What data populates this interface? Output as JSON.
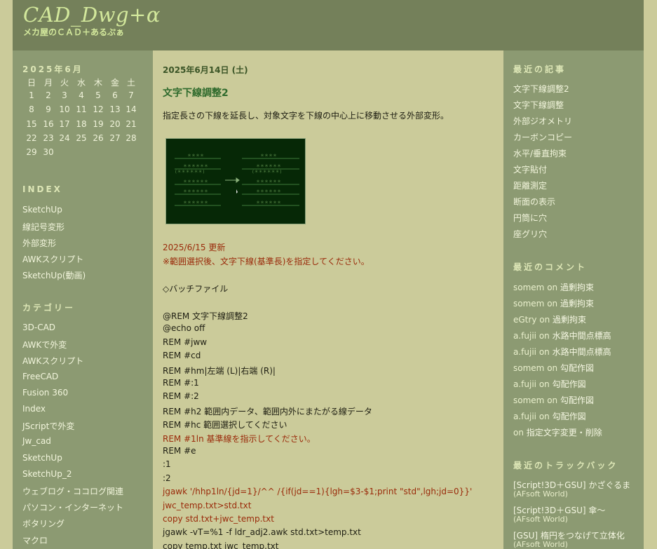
{
  "site": {
    "title": "CAD_Dwg+α",
    "subtitle": "メカ屋のＣＡＤ＋あるぷぁ"
  },
  "calendar": {
    "title": "2025年6月",
    "weekdays": [
      "日",
      "月",
      "火",
      "水",
      "木",
      "金",
      "土"
    ],
    "rows": [
      [
        "1",
        "2",
        "3",
        "4",
        "5",
        "6",
        "7"
      ],
      [
        "8",
        "9",
        "10",
        "11",
        "12",
        "13",
        "14"
      ],
      [
        "15",
        "16",
        "17",
        "18",
        "19",
        "20",
        "21"
      ],
      [
        "22",
        "23",
        "24",
        "25",
        "26",
        "27",
        "28"
      ],
      [
        "29",
        "30",
        "",
        "",
        "",
        "",
        ""
      ]
    ]
  },
  "index": {
    "heading": "INDEX",
    "items": [
      "SketchUp",
      "線記号変形",
      "外部変形",
      "AWKスクリプト",
      "SketchUp(動画)"
    ]
  },
  "categories": {
    "heading": "カテゴリー",
    "items": [
      "3D-CAD",
      "AWKで外変",
      "AWKスクリプト",
      "FreeCAD",
      "Fusion 360",
      "Index",
      "JScriptで外変",
      "Jw_cad",
      "SketchUp",
      "SketchUp_2",
      "ウェブログ・ココログ関連",
      "パソコン・インターネット",
      "ボタリング",
      "マクロ"
    ]
  },
  "post": {
    "date": "2025年6月14日 (土)",
    "title": "文字下線調整2",
    "lead": "指定長さの下線を延長し、対象文字を下線の中心上に移動させる外部変形。",
    "update_date": "2025/6/15 更新",
    "update_note": "※範囲選択後、文字下線(基準長)を指定してください。",
    "batch_heading": "◇バッチファイル",
    "code_lines": [
      {
        "text": "@REM 文字下線調整2",
        "red": false
      },
      {
        "text": "@echo off",
        "red": false
      },
      {
        "text": "REM #jww",
        "red": false
      },
      {
        "text": "REM #cd",
        "red": false
      },
      {
        "text": "REM #hm|左端 (L)|右端 (R)|",
        "red": false
      },
      {
        "text": "REM #:1",
        "red": false
      },
      {
        "text": "REM #:2",
        "red": false
      },
      {
        "text": "REM #h2 範囲内データ、範囲内外にまたがる線データ",
        "red": false
      },
      {
        "text": "REM #hc 範囲選択してください",
        "red": false
      },
      {
        "text": "REM #1ln 基準線を指示してください。",
        "red": true
      },
      {
        "text": "REM #e",
        "red": false
      },
      {
        "text": ":1",
        "red": false
      },
      {
        "text": ":2",
        "red": false
      },
      {
        "text": "jgawk '/hhp1ln/{jd=1}/^^ /{if(jd==1){lgh=$3-$1;print \"std\",lgh;jd=0}}'",
        "red": true
      },
      {
        "text": "jwc_temp.txt>std.txt",
        "red": true
      },
      {
        "text": "copy std.txt+jwc_temp.txt",
        "red": true
      },
      {
        "text": "jgawk -vT=%1 -f ldr_adj2.awk std.txt>temp.txt",
        "red": false
      },
      {
        "text": "copy temp.txt jwc_temp.txt",
        "red": false
      }
    ]
  },
  "recent_posts": {
    "heading": "最近の記事",
    "items": [
      "文字下線調整2",
      "文字下線調整",
      "外部ジオメトリ",
      "カーボンコピー",
      "水平/垂直拘束",
      "文字貼付",
      "距離測定",
      "断面の表示",
      "円筒に穴",
      "座グリ穴"
    ]
  },
  "recent_comments": {
    "heading": "最近のコメント",
    "connector": "on",
    "items": [
      {
        "who": "somem",
        "title": "過剰拘束"
      },
      {
        "who": "somem",
        "title": "過剰拘束"
      },
      {
        "who": "eGtry",
        "title": "過剰拘束"
      },
      {
        "who": "a.fujii",
        "title": "水路中間点標高"
      },
      {
        "who": "a.fujii",
        "title": "水路中間点標高"
      },
      {
        "who": "somem",
        "title": "勾配作図"
      },
      {
        "who": "a.fujii",
        "title": "勾配作図"
      },
      {
        "who": "somem",
        "title": "勾配作図"
      },
      {
        "who": "a.fujii",
        "title": "勾配作図"
      },
      {
        "who": "",
        "title": "指定文字変更・削除"
      }
    ]
  },
  "trackbacks": {
    "heading": "最近のトラックバック",
    "items": [
      {
        "title": "[Script!3D＋GSU] かざぐるま",
        "source": "(AFsoft World)"
      },
      {
        "title": "[Script!3D＋GSU] 傘〜",
        "source": "(AFsoft World)"
      },
      {
        "title": "[GSU] 楕円をつなげて立体化",
        "source": "(AFsoft World)"
      }
    ]
  }
}
